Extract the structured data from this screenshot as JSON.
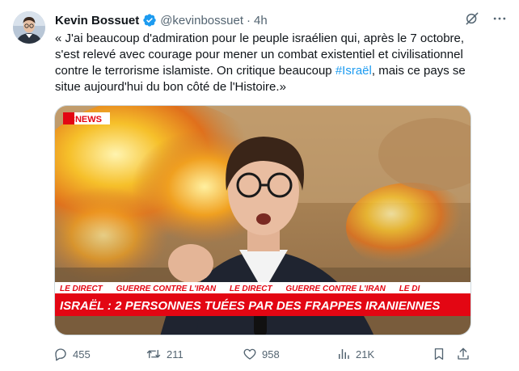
{
  "tweet": {
    "author_name": "Kevin Bossuet",
    "handle": "@kevinbossuet",
    "separator": "·",
    "time": "4h",
    "text_part1": "« J'ai beaucoup d'admiration pour le peuple israélien qui, après le 7 octobre, s'est relevé avec courage pour mener un combat existentiel et civilisationnel contre le terrorisme islamiste. On critique beaucoup ",
    "hashtag": "#Israël",
    "text_part2": ", mais ce pays se situe aujourd'hui du bon côté de l'Histoire.»"
  },
  "media": {
    "channel_logo": "CNEWS",
    "ticker_items": [
      "LE DIRECT",
      "GUERRE CONTRE L'IRAN",
      "LE DIRECT",
      "GUERRE CONTRE L'IRAN",
      "LE DI"
    ],
    "banner": "ISRAËL : 2 PERSONNES TUÉES PAR DES FRAPPES IRANIENNES"
  },
  "actions": {
    "replies": "455",
    "reposts": "211",
    "likes": "958",
    "views": "21K"
  },
  "icons": {
    "verified": "verified-badge-icon",
    "grok": "grok-icon",
    "more": "more-icon",
    "reply": "reply-icon",
    "repost": "repost-icon",
    "like": "like-icon",
    "views": "views-icon",
    "bookmark": "bookmark-icon",
    "share": "share-icon"
  },
  "colors": {
    "accent": "#1d9bf0",
    "muted": "#536471",
    "banner_red": "#e30613"
  }
}
